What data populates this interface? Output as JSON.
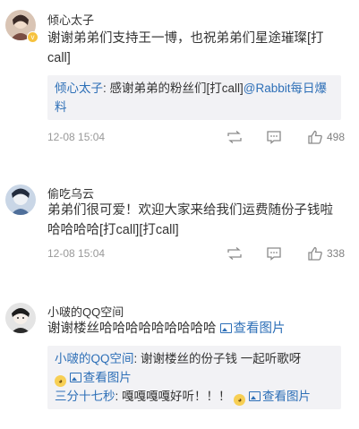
{
  "comments": [
    {
      "username": "倾心太子",
      "text": "谢谢弟弟们支持王一博，也祝弟弟们星途璀璨[打call]",
      "reply": {
        "author": "倾心太子",
        "text": ": 感谢弟弟的粉丝们[打call]",
        "mention": "@Rabbit每日爆料"
      },
      "time": "12-08 15:04",
      "likes": "498"
    },
    {
      "username": "偷吃乌云",
      "text": "弟弟们很可爱！欢迎大家来给我们运费随份子钱啦哈哈哈哈[打call][打call]",
      "time": "12-08 15:04",
      "likes": "338"
    },
    {
      "username": "小啵的QQ空间",
      "text": "谢谢楼丝哈哈哈哈哈哈哈哈哈",
      "view_pic": "查看图片",
      "replies": [
        {
          "author": "小啵的QQ空间",
          "text": ": 谢谢楼丝的份子钱 一起听歌呀",
          "view_pic": "查看图片"
        },
        {
          "author": "三分十七秒",
          "text": ": 嘎嘎嘎嘎好听！！！",
          "view_pic": "查看图片"
        }
      ]
    }
  ],
  "colors": {
    "link": "#2d6fb7",
    "meta": "#999999",
    "quote_bg": "#f2f2f5",
    "badge": "#f6c23e"
  },
  "icons": [
    "repost-icon",
    "comment-icon",
    "like-icon",
    "picture-icon",
    "emoji-icon"
  ]
}
